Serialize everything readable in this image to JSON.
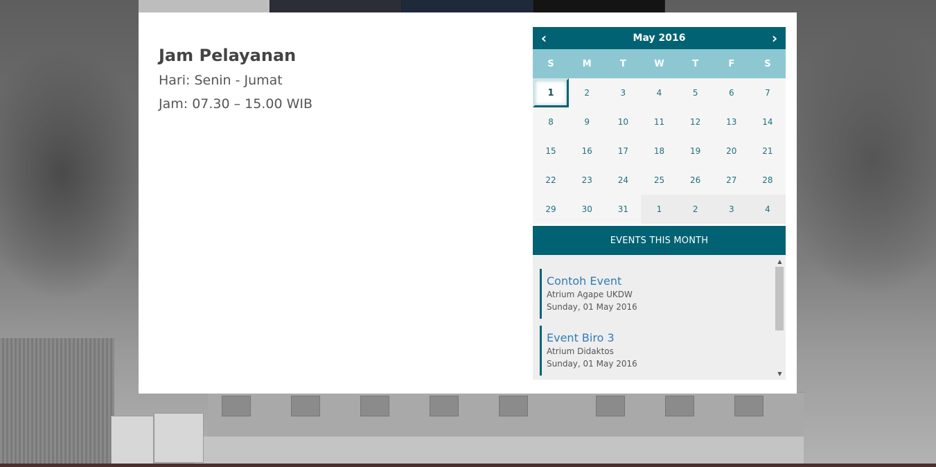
{
  "hours": {
    "title": "Jam Pelayanan",
    "days": "Hari: Senin - Jumat",
    "time": "Jam: 07.30 – 15.00 WIB"
  },
  "calendar": {
    "month_label": "May 2016",
    "prev_icon": "chevron-left-icon",
    "next_icon": "chevron-right-icon",
    "weekdays": [
      "S",
      "M",
      "T",
      "W",
      "T",
      "F",
      "S"
    ],
    "days": [
      {
        "label": "1",
        "current": true,
        "today": true
      },
      {
        "label": "2",
        "current": true
      },
      {
        "label": "3",
        "current": true
      },
      {
        "label": "4",
        "current": true
      },
      {
        "label": "5",
        "current": true
      },
      {
        "label": "6",
        "current": true
      },
      {
        "label": "7",
        "current": true
      },
      {
        "label": "8",
        "current": true
      },
      {
        "label": "9",
        "current": true
      },
      {
        "label": "10",
        "current": true
      },
      {
        "label": "11",
        "current": true
      },
      {
        "label": "12",
        "current": true
      },
      {
        "label": "13",
        "current": true
      },
      {
        "label": "14",
        "current": true
      },
      {
        "label": "15",
        "current": true
      },
      {
        "label": "16",
        "current": true
      },
      {
        "label": "17",
        "current": true
      },
      {
        "label": "18",
        "current": true
      },
      {
        "label": "19",
        "current": true
      },
      {
        "label": "20",
        "current": true
      },
      {
        "label": "21",
        "current": true
      },
      {
        "label": "22",
        "current": true
      },
      {
        "label": "23",
        "current": true
      },
      {
        "label": "24",
        "current": true
      },
      {
        "label": "25",
        "current": true
      },
      {
        "label": "26",
        "current": true
      },
      {
        "label": "27",
        "current": true
      },
      {
        "label": "28",
        "current": true
      },
      {
        "label": "29",
        "current": true
      },
      {
        "label": "30",
        "current": true
      },
      {
        "label": "31",
        "current": true
      },
      {
        "label": "1",
        "current": false
      },
      {
        "label": "2",
        "current": false
      },
      {
        "label": "3",
        "current": false
      },
      {
        "label": "4",
        "current": false
      }
    ],
    "colors": {
      "header": "#006272",
      "weekday_row": "#8dc8d2",
      "day_text": "#1f6f7e"
    }
  },
  "events": {
    "heading": "EVENTS THIS MONTH",
    "items": [
      {
        "title": "Contoh Event",
        "location": "Atrium Agape UKDW",
        "date": "Sunday, 01 May 2016"
      },
      {
        "title": "Event Biro 3",
        "location": "Atrium Didaktos",
        "date": "Sunday, 01 May 2016"
      }
    ]
  }
}
